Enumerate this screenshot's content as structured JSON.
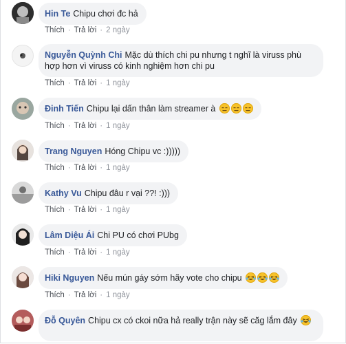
{
  "comments": [
    {
      "author": "Hin Te",
      "text": "Chipu chơi đc hả",
      "like": "Thích",
      "reply": "Trả lời",
      "time": "2 ngày"
    },
    {
      "author": "Nguyễn Quỳnh Chi",
      "text": "Mặc dù thích chi pu nhưng t nghĩ là viruss phù hợp hơn vì viruss có kinh nghiệm hơn chi pu",
      "like": "Thích",
      "reply": "Trả lời",
      "time": "1 ngày"
    },
    {
      "author": "Đinh Tiến",
      "text": "Chipu lại dấn thân làm streamer à",
      "like": "Thích",
      "reply": "Trả lời",
      "time": "1 ngày",
      "emojis": [
        "expressionless-face-icon",
        "expressionless-face-icon",
        "expressionless-face-icon"
      ]
    },
    {
      "author": "Trang Nguyen",
      "text": "Hóng Chipu vc :)))))",
      "like": "Thích",
      "reply": "Trả lời",
      "time": "1 ngày"
    },
    {
      "author": "Kathy Vu",
      "text": "Chipu đâu r vại ??! :)))",
      "like": "Thích",
      "reply": "Trả lời",
      "time": "1 ngày"
    },
    {
      "author": "Lâm Diệu Ái",
      "text": "Chi PU có chơi PUbg",
      "like": "Thích",
      "reply": "Trả lời",
      "time": "1 ngày"
    },
    {
      "author": "Hiki Nguyen",
      "text": "Nếu mún gáy sớm hãy vote cho chipu",
      "like": "Thích",
      "reply": "Trả lời",
      "time": "1 ngày",
      "emojis": [
        "laughing-tears-face-icon",
        "laughing-tears-face-icon",
        "laughing-tears-face-icon"
      ]
    },
    {
      "author": "Đỗ Quyên",
      "text": "Chipu cx có ckoi nữa hả really trận này sẽ căg lắm đây",
      "emojis": [
        "laughing-tears-face-icon"
      ]
    }
  ],
  "separator": "·",
  "colors": {
    "author": "#385898",
    "bubble": "#f2f3f5",
    "meta": "#90949c"
  }
}
